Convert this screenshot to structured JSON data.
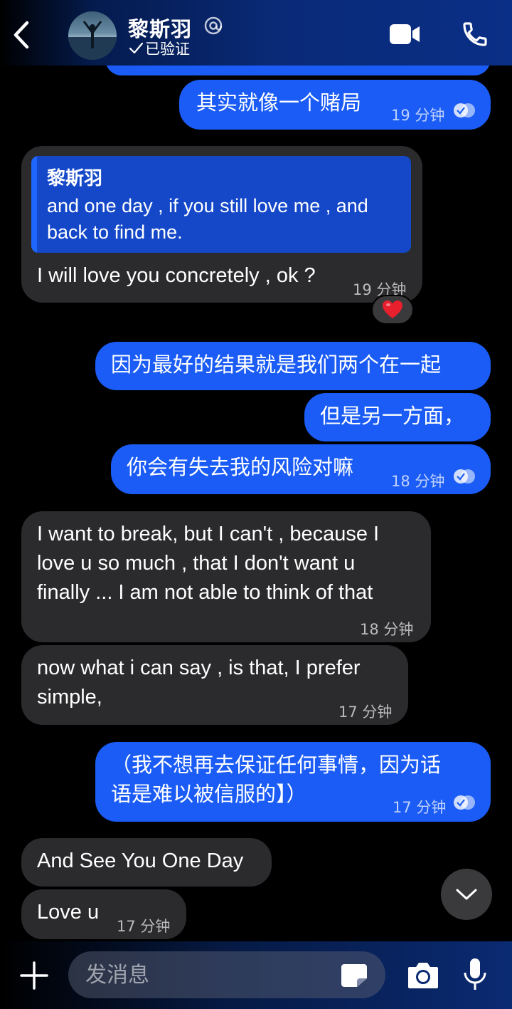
{
  "header": {
    "contact_name": "黎斯羽",
    "verified_label": "已验证"
  },
  "messages": {
    "m1": {
      "text": "其实就像一个赌局",
      "time": "19 分钟"
    },
    "m2": {
      "reply_author": "黎斯羽",
      "reply_text": "and one day , if you still love me , and back to find me.",
      "text": "I will love you concretely , ok ?",
      "time": "19 分钟",
      "reaction": "❤️"
    },
    "m3": {
      "text": "因为最好的结果就是我们两个在一起"
    },
    "m4": {
      "text": "但是另一方面，"
    },
    "m5": {
      "text": "你会有失去我的风险对嘛",
      "time": "18 分钟"
    },
    "m6": {
      "line1": "I want to break, but I can't , because I",
      "line2": "love u so much , that I don't want u",
      "line3": "finally ... I am not able to think of that",
      "time": "18 分钟"
    },
    "m7": {
      "line1": "now what i can say , is that, I prefer",
      "line2": "simple,",
      "time": "17 分钟"
    },
    "m8": {
      "line1": "（我不想再去保证任何事情，因为话",
      "line2": "语是难以被信服的】）",
      "time": "17 分钟"
    },
    "m9": {
      "text": "And See You One Day"
    },
    "m10": {
      "text": "Love u",
      "time": "17 分钟"
    }
  },
  "composer": {
    "placeholder": "发消息"
  },
  "colors": {
    "outgoing_bubble": "#1a5cf5",
    "incoming_bubble": "#2b2b2d",
    "background": "#000000"
  }
}
